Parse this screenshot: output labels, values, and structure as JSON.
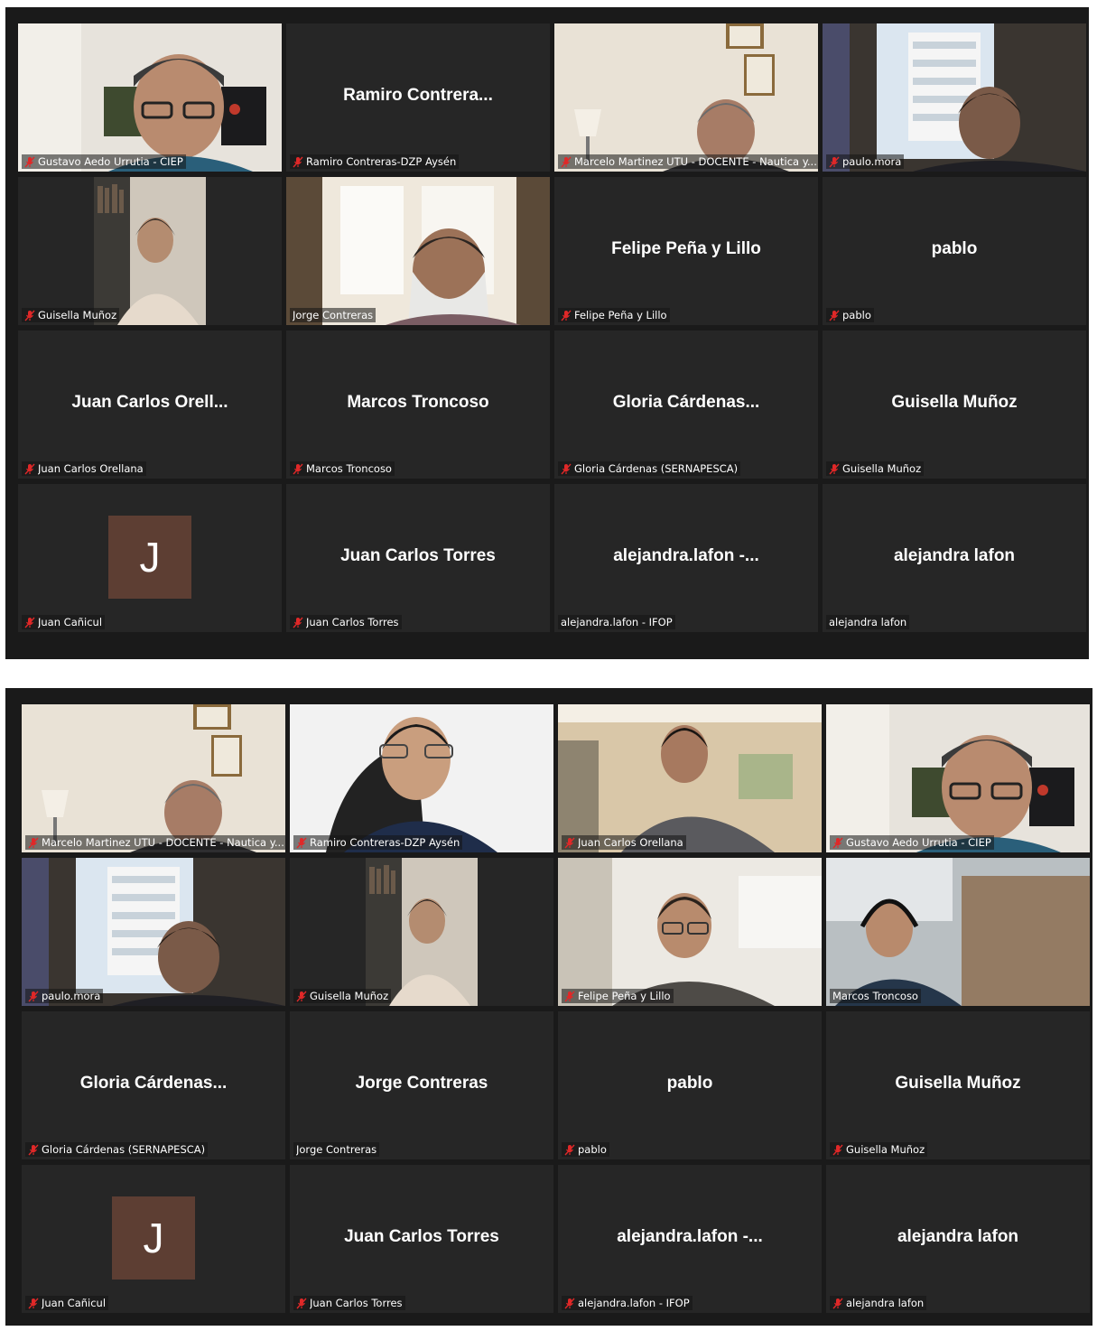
{
  "screenshots": [
    {
      "tiles": [
        {
          "type": "video",
          "scene": "office-posters",
          "label": "Gustavo Aedo Urrutia - CIEP",
          "muted": true
        },
        {
          "type": "name",
          "big_name": "Ramiro  Contrera...",
          "label": "Ramiro Contreras-DZP Aysén",
          "muted": true
        },
        {
          "type": "video",
          "scene": "office-lamp",
          "label": "Marcelo Martinez UTU - DOCENTE - Nautica y...",
          "muted": true
        },
        {
          "type": "video",
          "scene": "window-building",
          "label": "paulo.mora",
          "muted": true
        },
        {
          "type": "video",
          "scene": "bookshelf",
          "label": "Guisella Muñoz",
          "muted": true
        },
        {
          "type": "video",
          "scene": "window-bright",
          "label": "Jorge Contreras",
          "muted": false,
          "active": true
        },
        {
          "type": "name",
          "big_name": "Felipe Peña y Lillo",
          "label": "Felipe Peña y Lillo",
          "muted": true
        },
        {
          "type": "name",
          "big_name": "pablo",
          "label": "pablo",
          "muted": true
        },
        {
          "type": "name",
          "big_name": "Juan Carlos Orell...",
          "label": "Juan Carlos Orellana",
          "muted": true
        },
        {
          "type": "name",
          "big_name": "Marcos Troncoso",
          "label": "Marcos Troncoso",
          "muted": true
        },
        {
          "type": "name",
          "big_name": "Gloria  Cárdenas...",
          "label": "Gloria Cárdenas (SERNAPESCA)",
          "muted": true
        },
        {
          "type": "name",
          "big_name": "Guisella Muñoz",
          "label": "Guisella Muñoz",
          "muted": true
        },
        {
          "type": "avatar",
          "initial": "J",
          "label": "Juan Cañicul",
          "muted": true
        },
        {
          "type": "name",
          "big_name": "Juan Carlos Torres",
          "label": "Juan Carlos Torres",
          "muted": true
        },
        {
          "type": "name",
          "big_name": "alejandra.lafon  -...",
          "label": "alejandra.lafon - IFOP",
          "muted": false
        },
        {
          "type": "name",
          "big_name": "alejandra lafon",
          "label": "alejandra lafon",
          "muted": false
        }
      ]
    },
    {
      "tiles": [
        {
          "type": "video",
          "scene": "office-lamp",
          "label": "Marcelo Martinez UTU - DOCENTE - Nautica y...",
          "muted": true
        },
        {
          "type": "video",
          "scene": "home-chair",
          "label": "Ramiro Contreras-DZP Aysén",
          "muted": true
        },
        {
          "type": "video",
          "scene": "office-map",
          "label": "Juan Carlos Orellana",
          "muted": true
        },
        {
          "type": "video",
          "scene": "office-posters",
          "label": "Gustavo Aedo Urrutia - CIEP",
          "muted": true
        },
        {
          "type": "video",
          "scene": "window-building",
          "label": "paulo.mora",
          "muted": true
        },
        {
          "type": "video",
          "scene": "bookshelf",
          "label": "Guisella Muñoz",
          "muted": true
        },
        {
          "type": "video",
          "scene": "office-white",
          "label": "Felipe Peña y Lillo",
          "muted": true
        },
        {
          "type": "video",
          "scene": "blurred-headset",
          "label": "Marcos Troncoso",
          "muted": false,
          "active": true
        },
        {
          "type": "name",
          "big_name": "Gloria  Cárdenas...",
          "label": "Gloria Cárdenas (SERNAPESCA)",
          "muted": true
        },
        {
          "type": "name",
          "big_name": "Jorge Contreras",
          "label": "Jorge Contreras",
          "muted": false
        },
        {
          "type": "name",
          "big_name": "pablo",
          "label": "pablo",
          "muted": true
        },
        {
          "type": "name",
          "big_name": "Guisella Muñoz",
          "label": "Guisella Muñoz",
          "muted": true
        },
        {
          "type": "avatar",
          "initial": "J",
          "label": "Juan Cañicul",
          "muted": true
        },
        {
          "type": "name",
          "big_name": "Juan Carlos Torres",
          "label": "Juan Carlos Torres",
          "muted": true
        },
        {
          "type": "name",
          "big_name": "alejandra.lafon  -...",
          "label": "alejandra.lafon - IFOP",
          "muted": true
        },
        {
          "type": "name",
          "big_name": "alejandra lafon",
          "label": "alejandra lafon",
          "muted": true
        }
      ]
    }
  ],
  "colors": {
    "background": "#1a1a1a",
    "tile": "#262626",
    "active_border": "#d6e876",
    "muted_icon": "#e02828",
    "avatar": "#5d3e33"
  },
  "icons": {
    "muted": "microphone-muted-icon"
  }
}
